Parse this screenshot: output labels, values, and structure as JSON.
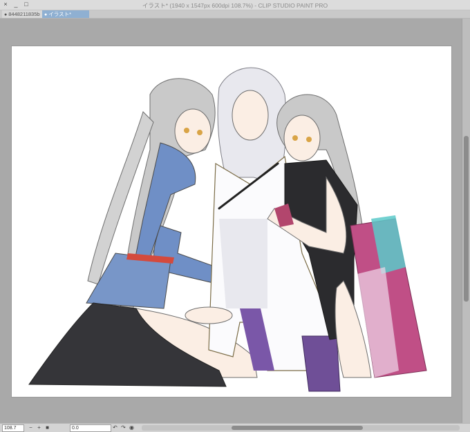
{
  "window": {
    "title": "イラスト* (1940 x 1547px 600dpi 108.7%) - CLIP STUDIO PAINT PRO",
    "close_glyph": "×",
    "minimize_glyph": "_",
    "maximize_glyph": "□"
  },
  "tabs": [
    {
      "label": "8448211835b",
      "active": false
    },
    {
      "label": "イラスト*",
      "active": true
    }
  ],
  "status": {
    "zoom_value": "108.7",
    "zoom_out_glyph": "−",
    "zoom_in_glyph": "+",
    "fit_glyph": "■",
    "angle_value": "0.0",
    "rotate_left_glyph": "↶",
    "rotate_right_glyph": "↷",
    "reset_glyph": "◉"
  },
  "colors": {
    "app_background": "#a9a9a9",
    "active_tab": "#8fb0d2",
    "canvas": "#ffffff"
  }
}
